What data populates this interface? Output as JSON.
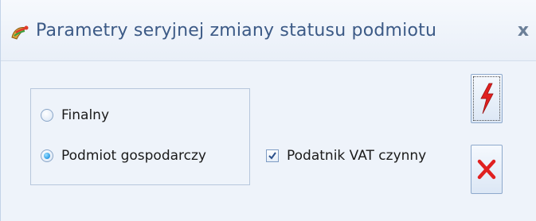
{
  "window": {
    "title": "Parametry seryjnej zmiany statusu podmiotu",
    "close_label": "x"
  },
  "options": {
    "radio_finalny": {
      "label": "Finalny",
      "checked": false
    },
    "radio_podmiot": {
      "label": "Podmiot gospodarczy",
      "checked": true
    },
    "checkbox_vat": {
      "label": "Podatnik VAT czynny",
      "checked": true
    }
  },
  "buttons": {
    "run_icon": "lightning-icon",
    "cancel_icon": "red-x-icon"
  },
  "colors": {
    "title_text": "#3c5a86",
    "accent_red": "#e02020",
    "radio_selected": "#3aa5e8"
  }
}
